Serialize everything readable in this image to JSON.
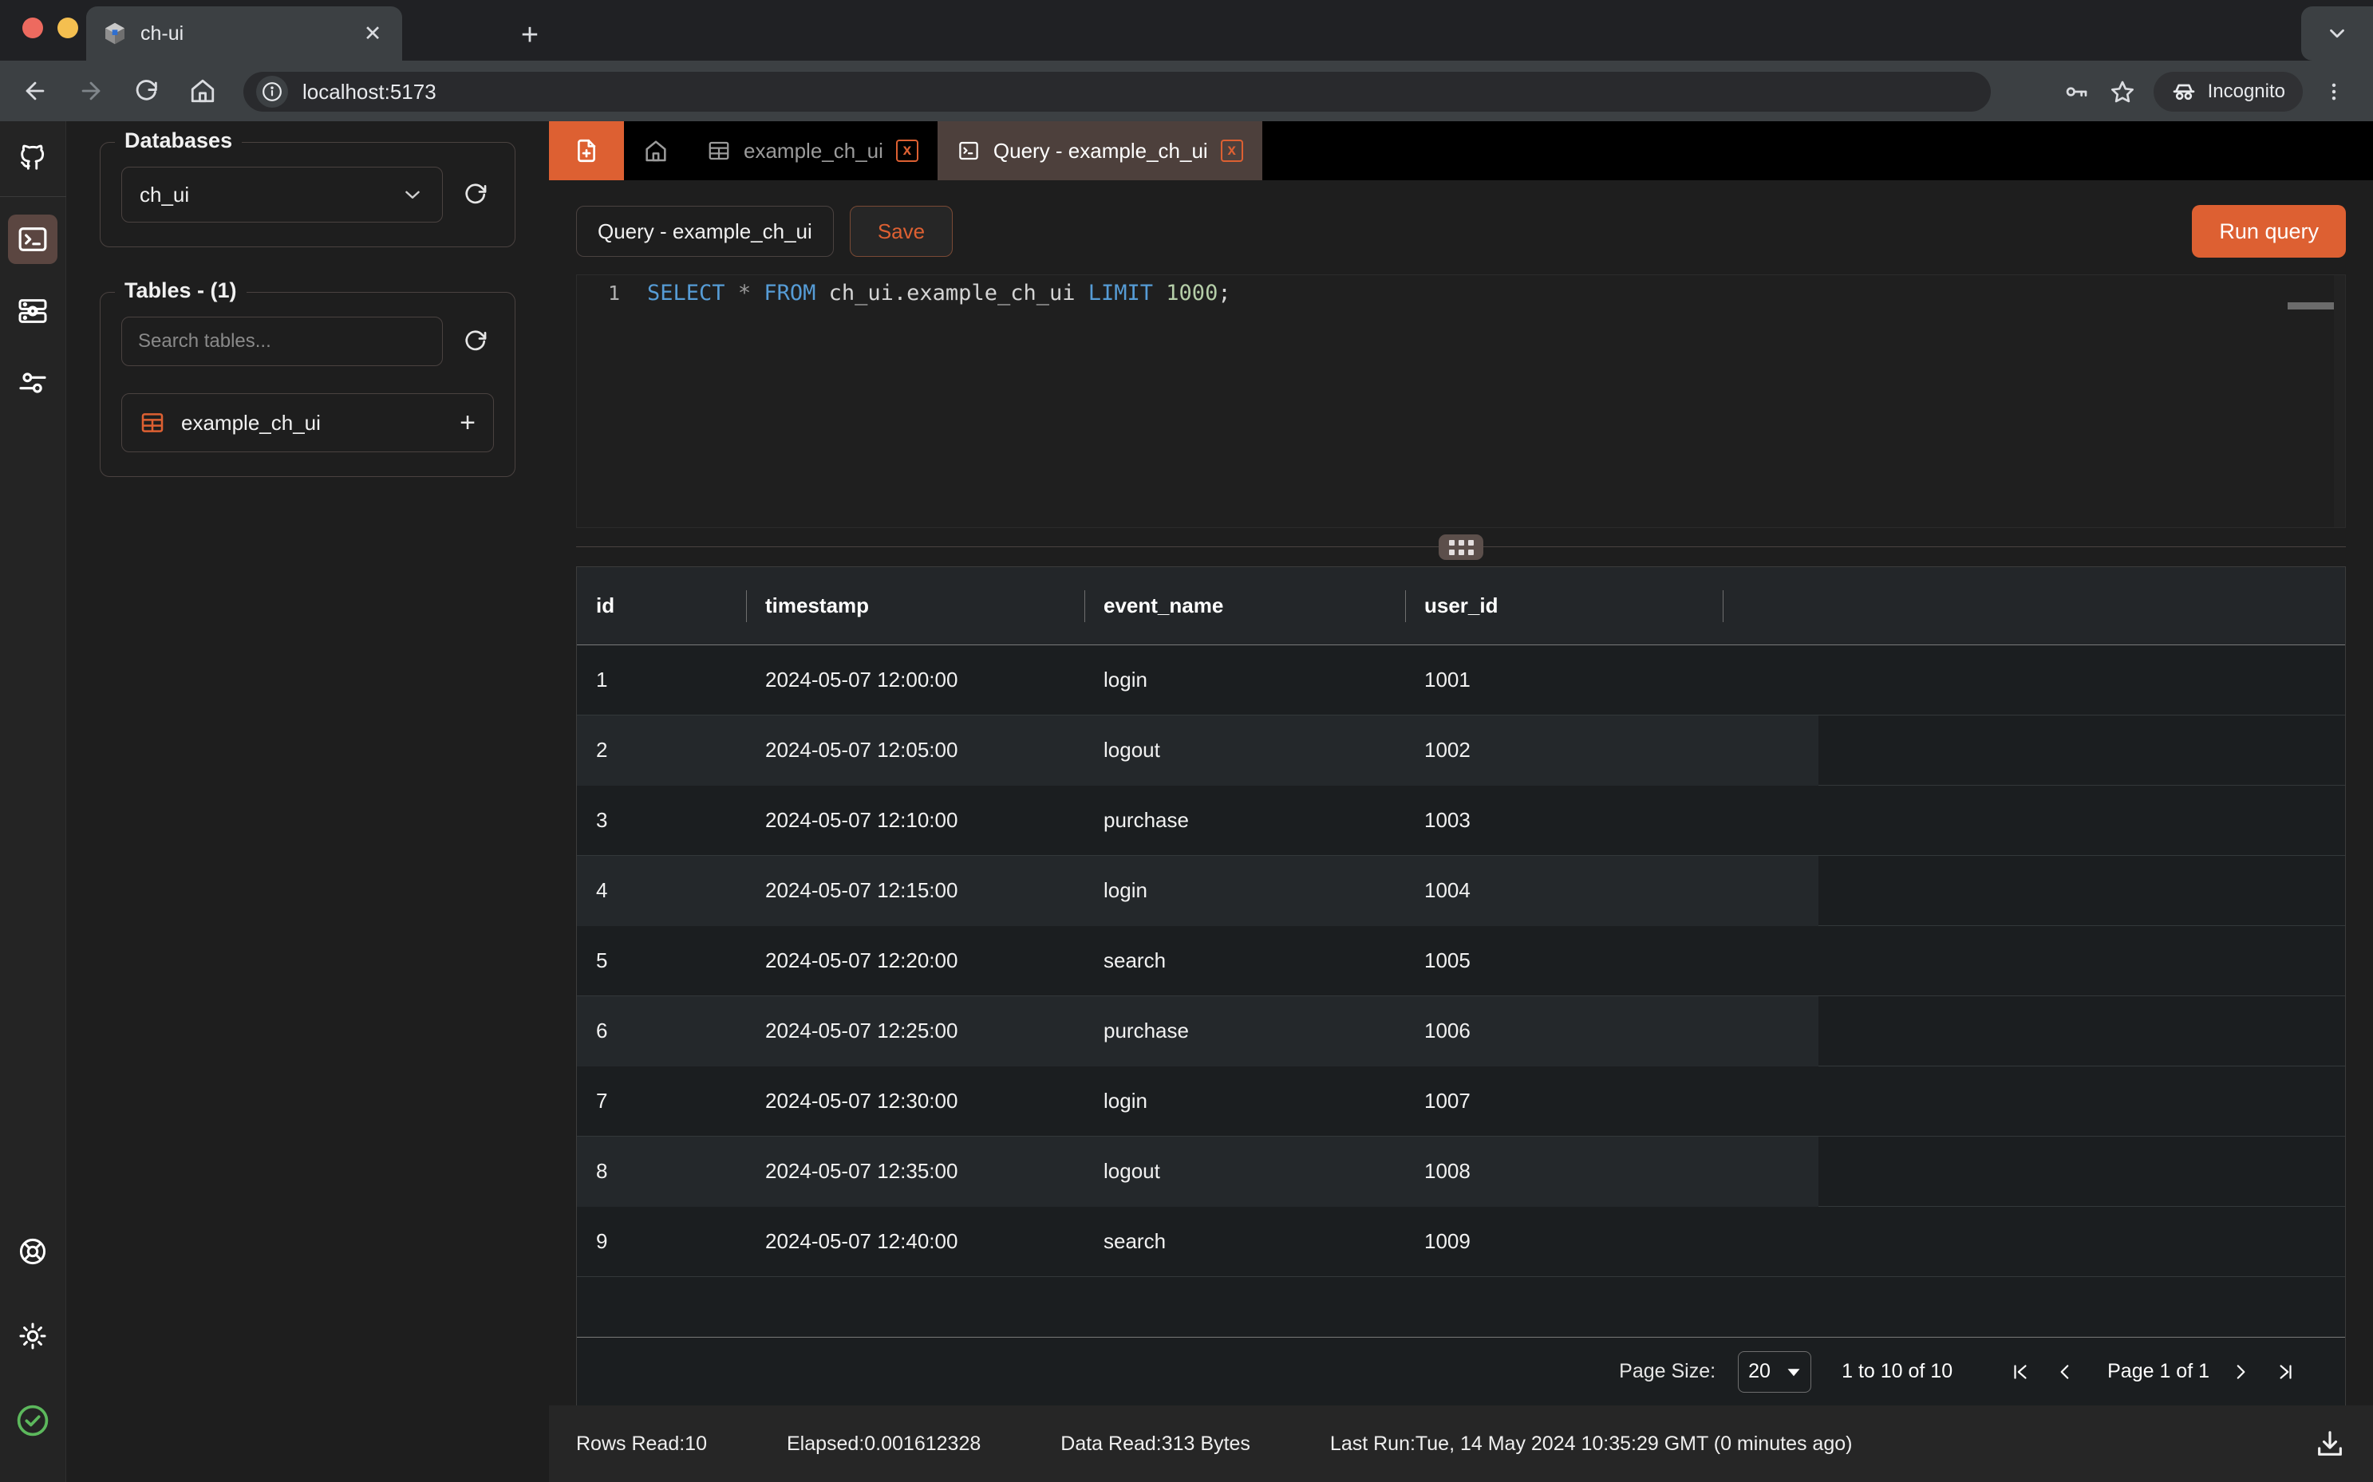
{
  "browser": {
    "tab_title": "ch-ui",
    "tab_close_label": "✕",
    "newtab_label": "+",
    "url": "localhost:5173",
    "incognito_label": "Incognito",
    "icons": {
      "back": "back-arrow-icon",
      "forward": "forward-arrow-icon",
      "reload": "reload-icon",
      "home": "home-icon",
      "info": "info-circle-icon",
      "password": "key-icon",
      "bookmark": "star-icon",
      "menu": "kebab-menu-icon",
      "tabstrip_expand": "chevron-down-icon"
    }
  },
  "rail": {
    "top_items": [
      {
        "name": "github-icon",
        "active": false
      },
      {
        "name": "terminal-icon",
        "active": true
      },
      {
        "name": "server-settings-icon",
        "active": false
      },
      {
        "name": "sliders-icon",
        "active": false
      }
    ],
    "bottom_items": [
      {
        "name": "lifebuoy-icon"
      },
      {
        "name": "sun-icon"
      },
      {
        "name": "connection-ok-icon"
      }
    ]
  },
  "sidebar": {
    "databases": {
      "legend": "Databases",
      "selected": "ch_ui",
      "refresh_icon": "refresh-icon",
      "chevron_icon": "chevron-down-icon"
    },
    "tables": {
      "legend": "Tables - (1)",
      "search_placeholder": "Search tables...",
      "search_value": "",
      "refresh_icon": "refresh-icon",
      "items": [
        {
          "name": "example_ch_ui",
          "icon": "table-icon",
          "add_label": "+"
        }
      ]
    }
  },
  "apptabs": {
    "new_query_icon": "new-file-icon",
    "home_icon": "home-icon",
    "items": [
      {
        "label": "example_ch_ui",
        "icon": "table-icon",
        "active": false,
        "close_label": "x"
      },
      {
        "label": "Query - example_ch_ui",
        "icon": "terminal-icon",
        "active": true,
        "close_label": "x"
      }
    ]
  },
  "query": {
    "name_value": "Query - example_ch_ui",
    "save_label": "Save",
    "run_label": "Run query",
    "editor": {
      "line_number": "1",
      "tokens": [
        {
          "t": "SELECT",
          "c": "kw"
        },
        {
          "t": " ",
          "c": ""
        },
        {
          "t": "*",
          "c": "op"
        },
        {
          "t": " ",
          "c": ""
        },
        {
          "t": "FROM",
          "c": "kw"
        },
        {
          "t": " ch_ui.example_ch_ui ",
          "c": ""
        },
        {
          "t": "LIMIT",
          "c": "kw"
        },
        {
          "t": " ",
          "c": ""
        },
        {
          "t": "1000",
          "c": "num"
        },
        {
          "t": ";",
          "c": ""
        }
      ],
      "full_text": "SELECT * FROM ch_ui.example_ch_ui LIMIT 1000;"
    }
  },
  "results": {
    "columns": [
      "id",
      "timestamp",
      "event_name",
      "user_id",
      ""
    ],
    "rows": [
      [
        "1",
        "2024-05-07 12:00:00",
        "login",
        "1001",
        ""
      ],
      [
        "2",
        "2024-05-07 12:05:00",
        "logout",
        "1002",
        ""
      ],
      [
        "3",
        "2024-05-07 12:10:00",
        "purchase",
        "1003",
        ""
      ],
      [
        "4",
        "2024-05-07 12:15:00",
        "login",
        "1004",
        ""
      ],
      [
        "5",
        "2024-05-07 12:20:00",
        "search",
        "1005",
        ""
      ],
      [
        "6",
        "2024-05-07 12:25:00",
        "purchase",
        "1006",
        ""
      ],
      [
        "7",
        "2024-05-07 12:30:00",
        "login",
        "1007",
        ""
      ],
      [
        "8",
        "2024-05-07 12:35:00",
        "logout",
        "1008",
        ""
      ],
      [
        "9",
        "2024-05-07 12:40:00",
        "search",
        "1009",
        ""
      ]
    ],
    "pagination": {
      "page_size_label": "Page Size:",
      "page_size_value": "20",
      "range_text": "1 to 10 of 10",
      "page_text": "Page 1 of 1",
      "first_icon": "first-page-icon",
      "prev_icon": "prev-page-icon",
      "next_icon": "next-page-icon",
      "last_icon": "last-page-icon"
    }
  },
  "status": {
    "rows_read": "Rows Read:10",
    "elapsed": "Elapsed:0.001612328",
    "data_read": "Data Read:313 Bytes",
    "last_run": "Last Run:Tue, 14 May 2024 10:35:29 GMT (0 minutes ago)",
    "download_icon": "download-icon"
  },
  "colors": {
    "accent": "#dd6032",
    "active_tab": "#4d403c",
    "status_ok": "#5cb85c"
  }
}
